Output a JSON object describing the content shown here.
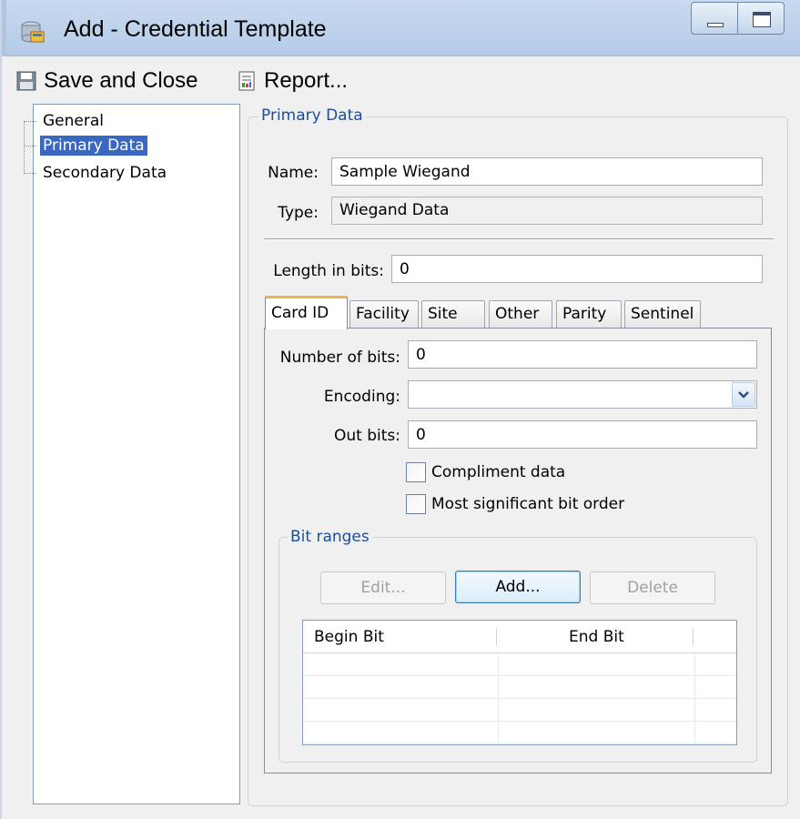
{
  "window": {
    "title": "Add - Credential Template"
  },
  "toolbar": {
    "save_label": "Save and Close",
    "report_label": "Report..."
  },
  "tree": {
    "items": [
      {
        "label": "General",
        "selected": false
      },
      {
        "label": "Primary Data",
        "selected": true
      },
      {
        "label": "Secondary Data",
        "selected": false
      }
    ]
  },
  "primary_group": {
    "title": "Primary Data",
    "name_label": "Name:",
    "name_value": "Sample Wiegand",
    "type_label": "Type:",
    "type_value": "Wiegand Data",
    "length_label": "Length in bits:",
    "length_value": "0"
  },
  "tabs": [
    {
      "label": "Card ID",
      "active": true
    },
    {
      "label": "Facility",
      "active": false
    },
    {
      "label": "Site",
      "active": false
    },
    {
      "label": "Other",
      "active": false
    },
    {
      "label": "Parity",
      "active": false
    },
    {
      "label": "Sentinel",
      "active": false
    }
  ],
  "card_id": {
    "num_bits_label": "Number of bits:",
    "num_bits_value": "0",
    "encoding_label": "Encoding:",
    "encoding_value": "",
    "out_bits_label": "Out bits:",
    "out_bits_value": "0",
    "compliment_label": "Compliment data",
    "compliment_checked": false,
    "msb_label": "Most significant bit order",
    "msb_checked": false
  },
  "bit_ranges": {
    "title": "Bit ranges",
    "edit_label": "Edit...",
    "add_label": "Add...",
    "delete_label": "Delete",
    "columns": [
      "Begin Bit",
      "End Bit"
    ],
    "rows": []
  },
  "colors": {
    "accent": "#1a4ea2",
    "selection": "#3a67c1",
    "tab_highlight": "#f1b24a"
  }
}
